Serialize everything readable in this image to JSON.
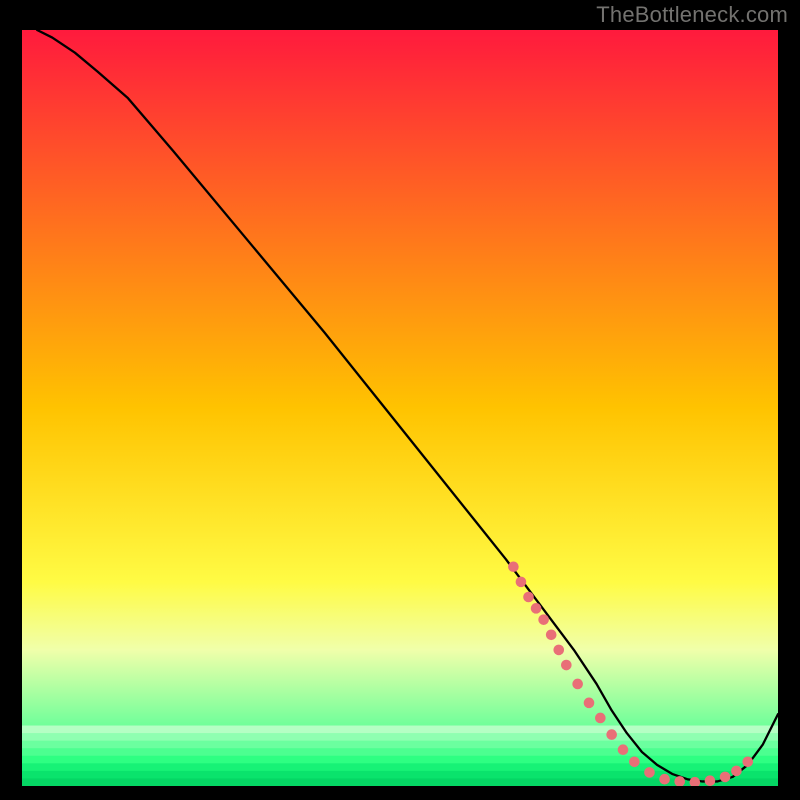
{
  "attribution": "TheBottleneck.com",
  "chart_data": {
    "type": "line",
    "title": "",
    "xlabel": "",
    "ylabel": "",
    "xlim": [
      0,
      100
    ],
    "ylim": [
      0,
      100
    ],
    "grid": false,
    "legend": false,
    "background_gradient": {
      "stops": [
        {
          "pos": 0.0,
          "color": "#ff1a3d"
        },
        {
          "pos": 0.5,
          "color": "#ffc300"
        },
        {
          "pos": 0.73,
          "color": "#fffb44"
        },
        {
          "pos": 0.82,
          "color": "#f0ffaa"
        },
        {
          "pos": 0.92,
          "color": "#70ff9a"
        },
        {
          "pos": 1.0,
          "color": "#00d66a"
        }
      ]
    },
    "bottom_band": {
      "from_y_pct": 92,
      "stripes": [
        "#b5ffc4",
        "#8fffb1",
        "#6bff9f",
        "#4cff90",
        "#2eff82",
        "#17f276",
        "#0ae36c",
        "#05d664"
      ]
    },
    "series": [
      {
        "name": "bottleneck-curve",
        "color": "#000000",
        "stroke_width": 2.3,
        "x": [
          2,
          4,
          7,
          10,
          14,
          20,
          30,
          40,
          50,
          60,
          64,
          67,
          70,
          73,
          76,
          78,
          80,
          82,
          84,
          86,
          88,
          90,
          92,
          94,
          96,
          98,
          100
        ],
        "y": [
          100,
          99,
          97,
          94.5,
          91,
          84,
          72,
          60,
          47.5,
          35,
          30,
          26,
          22,
          18,
          13.5,
          10,
          7,
          4.5,
          2.8,
          1.6,
          0.9,
          0.6,
          0.6,
          1.2,
          2.8,
          5.5,
          9.5
        ]
      }
    ],
    "markers": {
      "color": "#e96f77",
      "radius": 5.3,
      "points": [
        {
          "x": 65,
          "y": 29
        },
        {
          "x": 66,
          "y": 27
        },
        {
          "x": 67,
          "y": 25
        },
        {
          "x": 68,
          "y": 23.5
        },
        {
          "x": 69,
          "y": 22
        },
        {
          "x": 70,
          "y": 20
        },
        {
          "x": 71,
          "y": 18
        },
        {
          "x": 72,
          "y": 16
        },
        {
          "x": 73.5,
          "y": 13.5
        },
        {
          "x": 75,
          "y": 11
        },
        {
          "x": 76.5,
          "y": 9
        },
        {
          "x": 78,
          "y": 6.8
        },
        {
          "x": 79.5,
          "y": 4.8
        },
        {
          "x": 81,
          "y": 3.2
        },
        {
          "x": 83,
          "y": 1.8
        },
        {
          "x": 85,
          "y": 0.9
        },
        {
          "x": 87,
          "y": 0.6
        },
        {
          "x": 89,
          "y": 0.5
        },
        {
          "x": 91,
          "y": 0.7
        },
        {
          "x": 93,
          "y": 1.2
        },
        {
          "x": 94.5,
          "y": 2.0
        },
        {
          "x": 96,
          "y": 3.2
        }
      ]
    }
  }
}
